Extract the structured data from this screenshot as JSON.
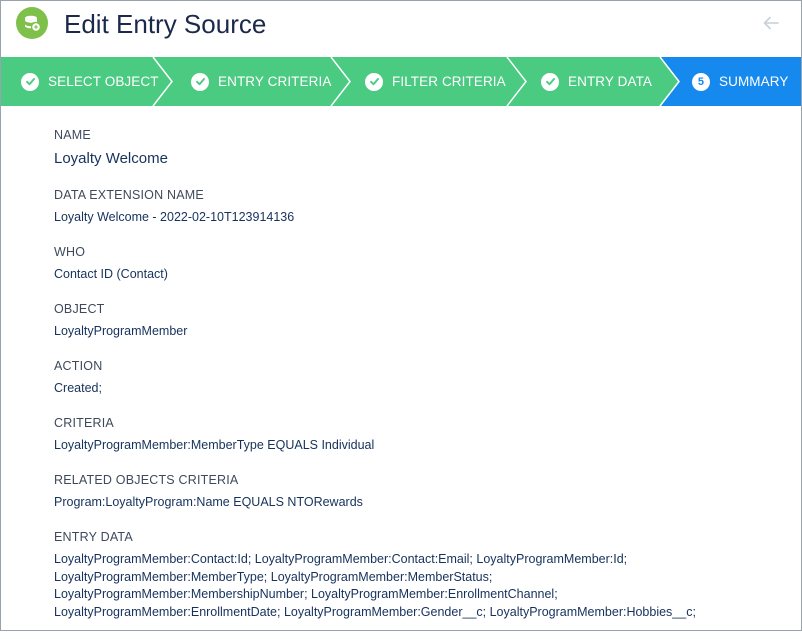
{
  "window": {
    "title": "Edit Entry Source"
  },
  "colors": {
    "completed_step": "#4bca81",
    "current_step": "#1589ee",
    "app_icon": "#7fc04a"
  },
  "icons": {
    "app": "entry-source-icon",
    "back": "back-arrow-icon",
    "completed": "check-icon"
  },
  "steps": [
    {
      "label": "SELECT OBJECT",
      "status": "complete"
    },
    {
      "label": "ENTRY CRITERIA",
      "status": "complete"
    },
    {
      "label": "FILTER CRITERIA",
      "status": "complete"
    },
    {
      "label": "ENTRY DATA",
      "status": "complete"
    },
    {
      "label": "SUMMARY",
      "status": "current",
      "number": "5"
    }
  ],
  "summary": {
    "name": {
      "label": "NAME",
      "value": "Loyalty Welcome"
    },
    "data_extension": {
      "label": "DATA EXTENSION NAME",
      "value": "Loyalty Welcome - 2022-02-10T123914136"
    },
    "who": {
      "label": "WHO",
      "value": "Contact ID (Contact)"
    },
    "object": {
      "label": "OBJECT",
      "value": "LoyaltyProgramMember"
    },
    "action": {
      "label": "ACTION",
      "value": "Created;"
    },
    "criteria": {
      "label": "CRITERIA",
      "value": "LoyaltyProgramMember:MemberType EQUALS Individual"
    },
    "related_criteria": {
      "label": "RELATED OBJECTS CRITERIA",
      "value": "Program:LoyaltyProgram:Name EQUALS NTORewards"
    },
    "entry_data": {
      "label": "ENTRY DATA",
      "lines": [
        "LoyaltyProgramMember:Contact:Id; LoyaltyProgramMember:Contact:Email; LoyaltyProgramMember:Id;",
        "LoyaltyProgramMember:MemberType; LoyaltyProgramMember:MemberStatus;",
        "LoyaltyProgramMember:MembershipNumber; LoyaltyProgramMember:EnrollmentChannel;",
        "LoyaltyProgramMember:EnrollmentDate; LoyaltyProgramMember:Gender__c; LoyaltyProgramMember:Hobbies__c;"
      ]
    }
  }
}
